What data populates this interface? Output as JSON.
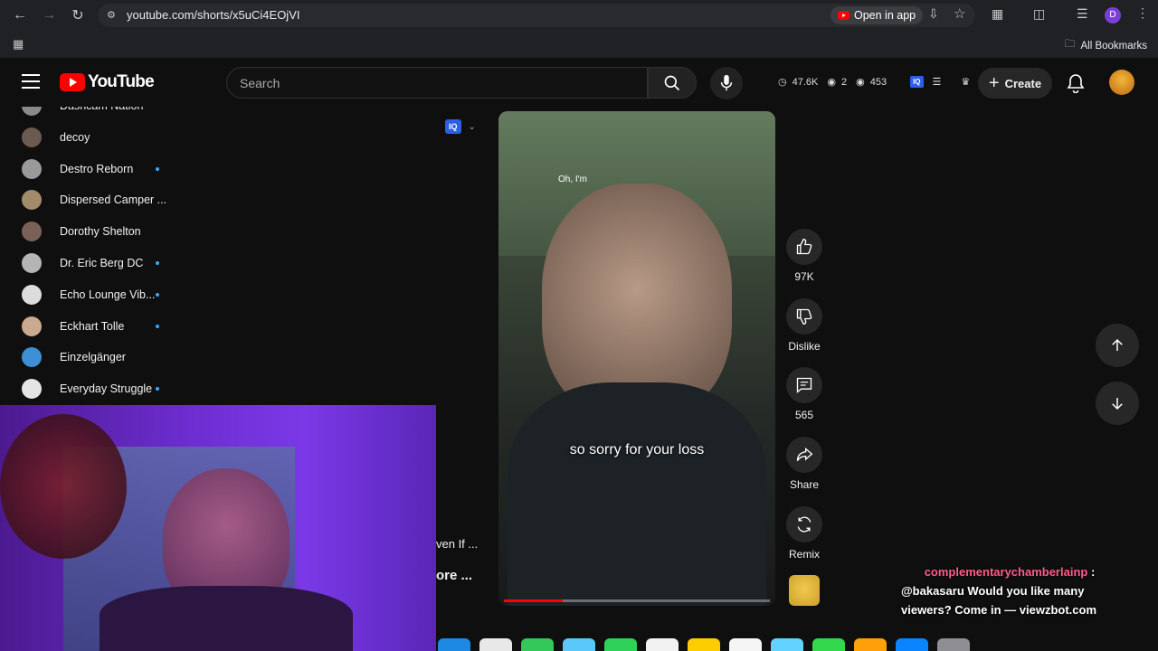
{
  "browser": {
    "url": "youtube.com/shorts/x5uCi4EOjVI",
    "open_in_app": "Open in app",
    "all_bookmarks": "All Bookmarks"
  },
  "header": {
    "logo_text": "YouTube",
    "search_placeholder": "Search",
    "stats": {
      "views_hours": "47.6K",
      "watching": "2",
      "viewers": "453"
    },
    "create_label": "Create"
  },
  "sidebar": {
    "subscriptions": [
      {
        "name": "Dashcam Nation",
        "dot": false,
        "color": "#8a8a8a"
      },
      {
        "name": "decoy",
        "dot": false,
        "color": "#6b5a50"
      },
      {
        "name": "Destro Reborn",
        "dot": true,
        "color": "#9a9a9a"
      },
      {
        "name": "Dispersed Camper ...",
        "dot": false,
        "color": "#a38a6b"
      },
      {
        "name": "Dorothy Shelton",
        "dot": false,
        "color": "#7a6156"
      },
      {
        "name": "Dr. Eric Berg DC",
        "dot": true,
        "color": "#b5b5b5"
      },
      {
        "name": "Echo Lounge Vib...",
        "dot": true,
        "color": "#dcdcdc"
      },
      {
        "name": "Eckhart Tolle",
        "dot": true,
        "color": "#c9a98f"
      },
      {
        "name": "Einzelgänger",
        "dot": false,
        "color": "#3d8fd6"
      },
      {
        "name": "Everyday Struggle",
        "dot": true,
        "color": "#e5e5e5"
      }
    ]
  },
  "short": {
    "caption_small": "Oh, I'm",
    "caption_main": "so sorry for your loss",
    "progress": 0.22,
    "partial_title_1": "ven If ...",
    "partial_title_2": "ore ..."
  },
  "actions": {
    "like_count": "97K",
    "dislike_label": "Dislike",
    "comments_count": "565",
    "share_label": "Share",
    "remix_label": "Remix"
  },
  "chat": {
    "user": "complementarychamberlainp",
    "separator": " :",
    "message": "@bakasaru Would you like many viewers? Come in — viewzbot.com"
  }
}
